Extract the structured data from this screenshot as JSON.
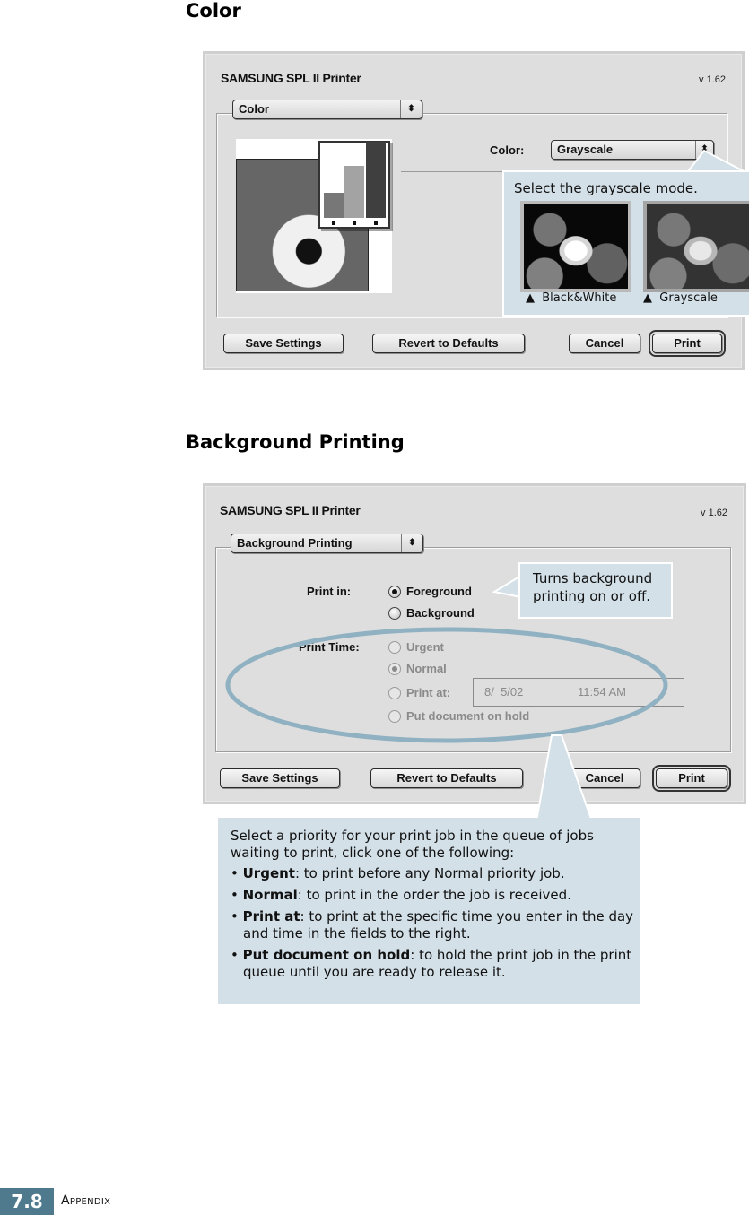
{
  "sections": {
    "color_title": "Color",
    "background_title": "Background Printing"
  },
  "color_dialog": {
    "title": "SAMSUNG SPL II Printer",
    "version": "v 1.62",
    "panel_popup": "Color",
    "color_label": "Color:",
    "color_value": "Grayscale",
    "buttons": {
      "save": "Save Settings",
      "revert": "Revert to Defaults",
      "cancel": "Cancel",
      "print": "Print"
    },
    "callout": {
      "text": "Select the grayscale mode.",
      "samples": [
        {
          "marker": "▲",
          "label": "Black&White"
        },
        {
          "marker": "▲",
          "label": "Grayscale"
        }
      ]
    }
  },
  "bg_dialog": {
    "title": "SAMSUNG SPL II Printer",
    "version": "v 1.62",
    "panel_popup": "Background Printing",
    "print_in_label": "Print in:",
    "print_in_options": [
      {
        "label": "Foreground",
        "selected": true
      },
      {
        "label": "Background",
        "selected": false
      }
    ],
    "print_time_label": "Print Time:",
    "print_time_options": [
      {
        "label": "Urgent",
        "selected": false
      },
      {
        "label": "Normal",
        "selected": true
      },
      {
        "label": "Print at:",
        "selected": false
      },
      {
        "label": "Put document on hold",
        "selected": false
      }
    ],
    "print_at_date": "8/  5/02",
    "print_at_time": "11:54 AM",
    "buttons": {
      "save": "Save Settings",
      "revert": "Revert to Defaults",
      "cancel": "Cancel",
      "print": "Print"
    },
    "callout_top": "Turns background printing on or off.",
    "callout_bottom": {
      "intro": "Select a priority for your print job in the queue of jobs waiting to print, click one of the following:",
      "items": [
        {
          "term": "Urgent",
          "desc": ": to print before any Normal priority job."
        },
        {
          "term": "Normal",
          "desc": ": to print in the order the job is received."
        },
        {
          "term": "Print at",
          "desc": ": to print at the specific time you enter in the day and time in the fields to the right."
        },
        {
          "term": "Put document on hold",
          "desc": ": to hold the print job in the print queue until you are ready to release it."
        }
      ]
    }
  },
  "footer": {
    "page_number": "7.8",
    "section": "Appendix"
  },
  "colors": {
    "callout_fill": "#d3e0e8",
    "highlight_ring": "#8fb1c2",
    "footer_accent": "#4f7a8e",
    "dialog_bg": "#dedede"
  }
}
